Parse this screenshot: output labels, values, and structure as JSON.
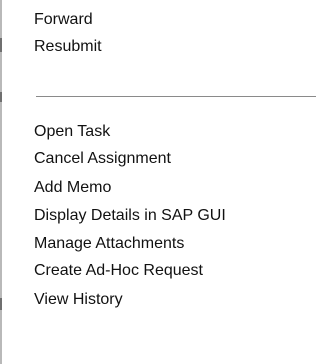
{
  "context_menu": {
    "group_top": [
      "Forward",
      "Resubmit"
    ],
    "group_bottom": [
      "Open Task",
      "Cancel Assignment",
      "Add Memo",
      "Display Details in SAP GUI",
      "Manage Attachments",
      "Create Ad-Hoc Request",
      "View History"
    ]
  }
}
